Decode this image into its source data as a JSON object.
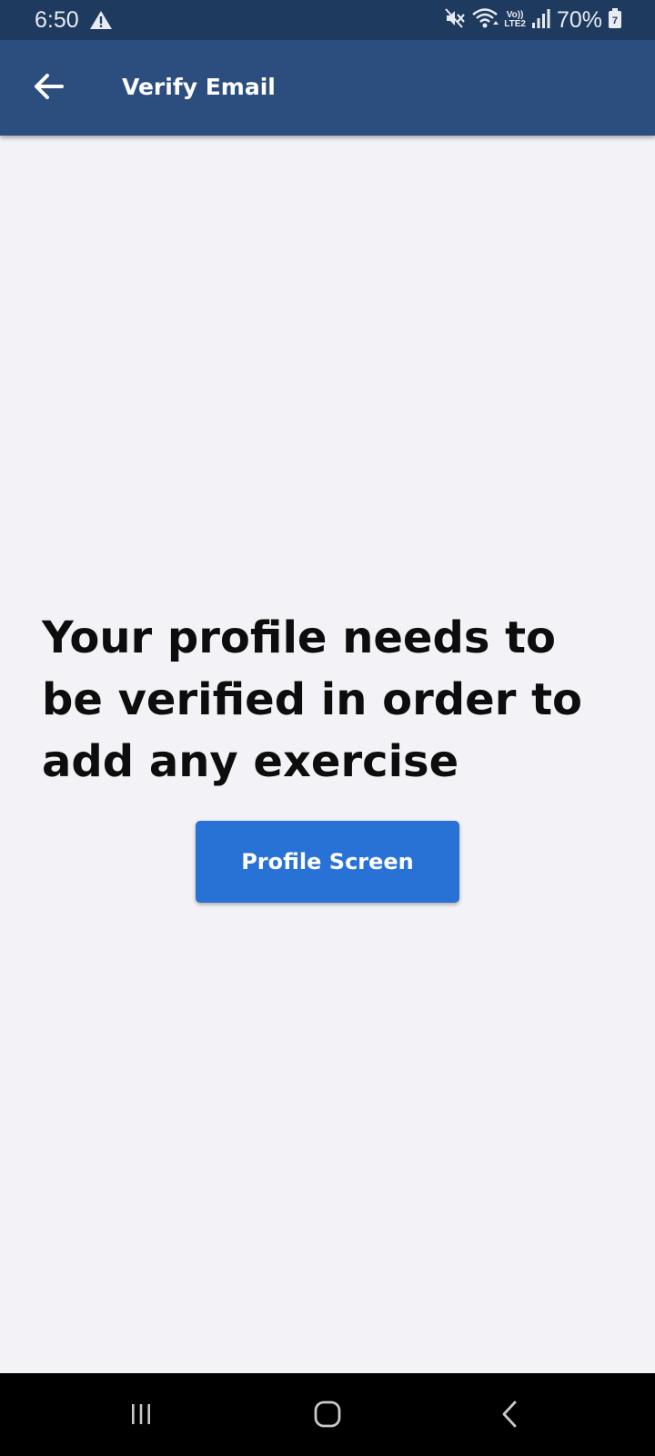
{
  "status_bar": {
    "time": "6:50",
    "battery": "70%",
    "network_top": "Vo))",
    "network_bottom": "LTE2",
    "battery_badge": "7",
    "icons": [
      "alert-triangle-icon",
      "mute-icon",
      "wifi-icon",
      "signal-icon",
      "battery-icon"
    ]
  },
  "app_bar": {
    "title": "Verify Email",
    "back_icon": "arrow-left-icon",
    "background_color": "#2c4e7e"
  },
  "main": {
    "message": "Your profile needs to be verified in order to add any exercise",
    "button_label": "Profile Screen",
    "button_color": "#2871d5"
  },
  "nav_bar": {
    "icons": [
      "recent-apps-icon",
      "home-icon",
      "back-icon"
    ]
  }
}
